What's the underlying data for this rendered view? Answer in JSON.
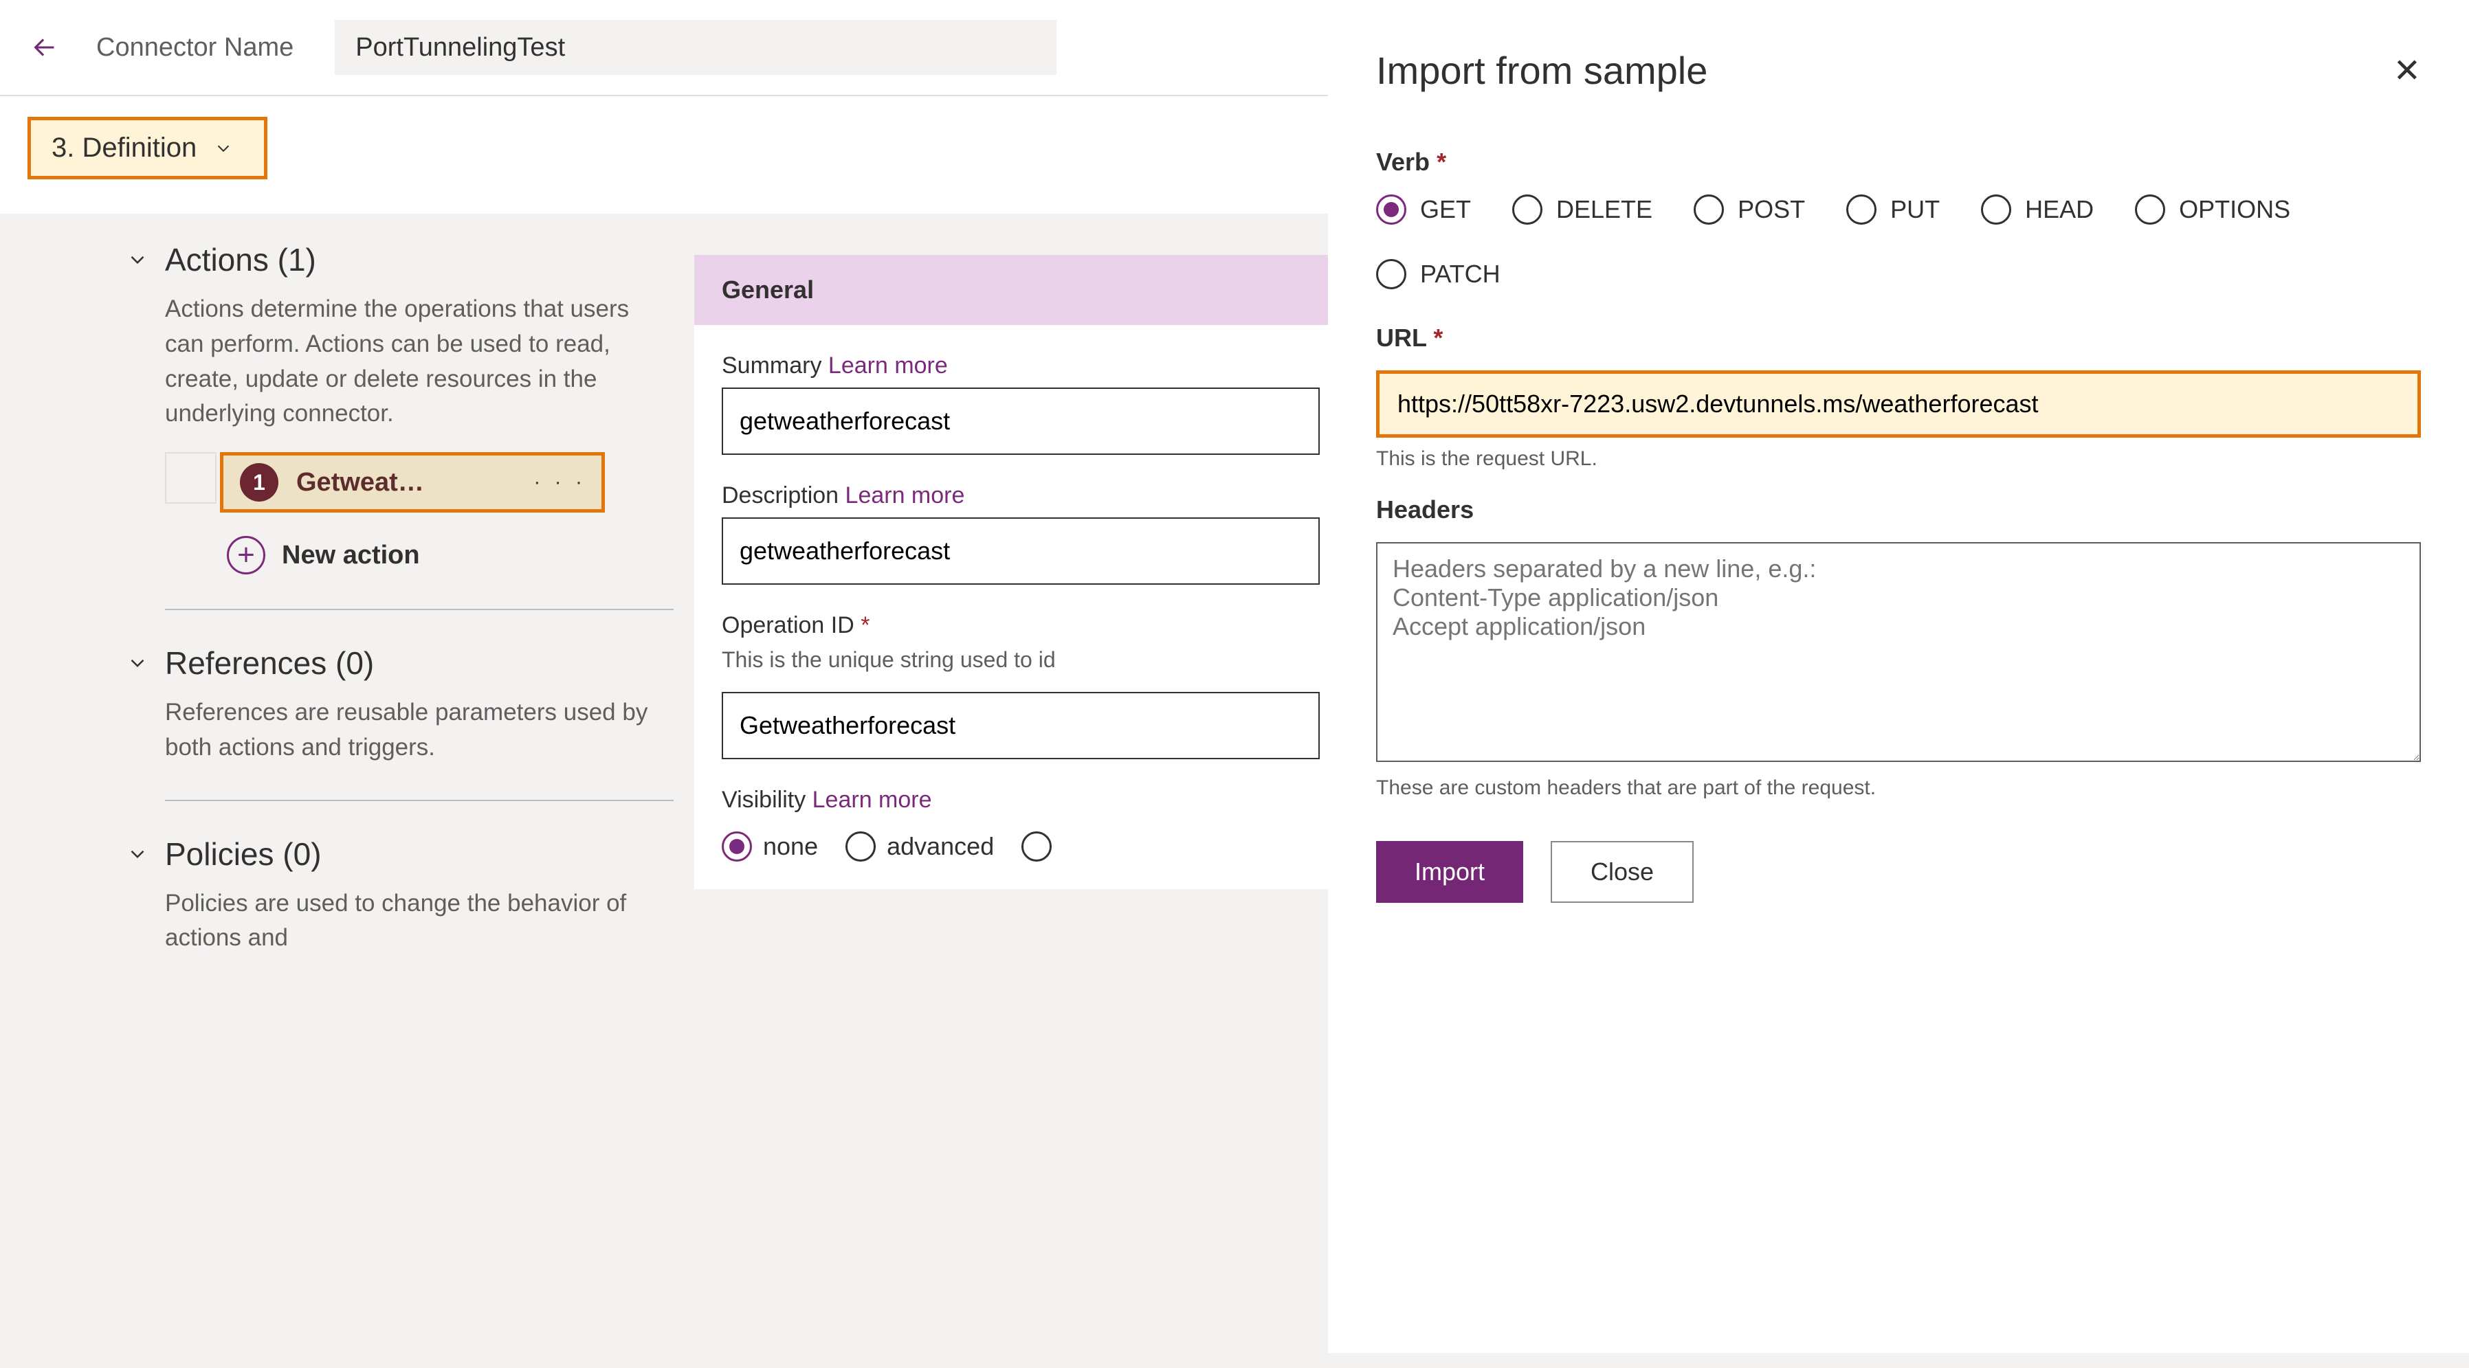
{
  "header": {
    "connector_name_label": "Connector Name",
    "connector_name_value": "PortTunnelingTest"
  },
  "step": {
    "label": "3. Definition"
  },
  "sections": {
    "actions": {
      "header": "Actions (1)",
      "desc": "Actions determine the operations that users can perform. Actions can be used to read, create, update or delete resources in the underlying connector.",
      "item_badge": "1",
      "item_label": "Getweat…",
      "new_action": "New action"
    },
    "references": {
      "header": "References (0)",
      "desc": "References are reusable parameters used by both actions and triggers."
    },
    "policies": {
      "header": "Policies (0)",
      "desc": "Policies are used to change the behavior of actions and"
    }
  },
  "general": {
    "header": "General",
    "summary_label": "Summary",
    "learn_more": "Learn more",
    "summary_value": "getweatherforecast",
    "description_label": "Description",
    "description_value": "getweatherforecast",
    "operation_id_label": "Operation ID",
    "operation_id_help": "This is the unique string used to id",
    "operation_id_value": "Getweatherforecast",
    "visibility_label": "Visibility",
    "visibility_options": [
      "none",
      "advanced"
    ]
  },
  "panel": {
    "title": "Import from sample",
    "verb_label": "Verb",
    "verbs": [
      "GET",
      "DELETE",
      "POST",
      "PUT",
      "HEAD",
      "OPTIONS",
      "PATCH"
    ],
    "verb_selected": "GET",
    "url_label": "URL",
    "url_value": "https://50tt58xr-7223.usw2.devtunnels.ms/weatherforecast",
    "url_help": "This is the request URL.",
    "headers_label": "Headers",
    "headers_placeholder": "Headers separated by a new line, e.g.:\nContent-Type application/json\nAccept application/json",
    "headers_help": "These are custom headers that are part of the request.",
    "import_btn": "Import",
    "close_btn": "Close"
  }
}
